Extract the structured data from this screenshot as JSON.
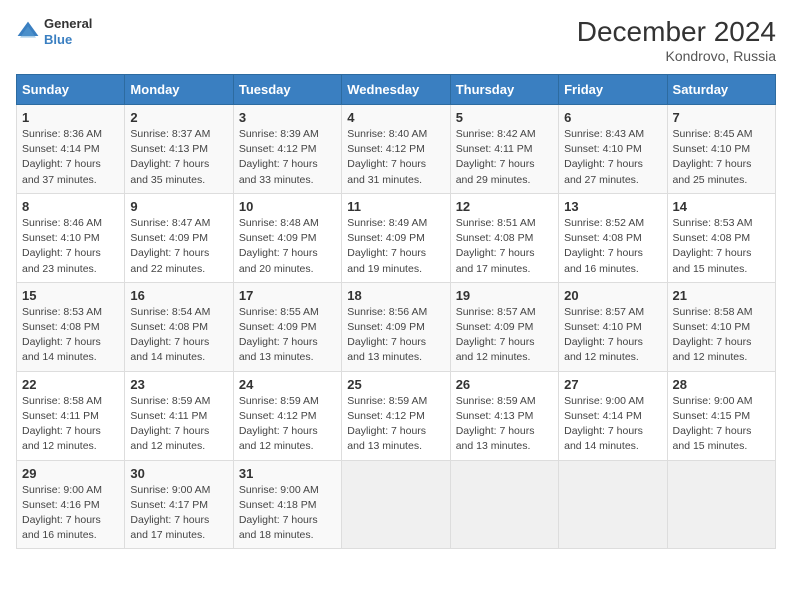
{
  "header": {
    "logo_line1": "General",
    "logo_line2": "Blue",
    "title": "December 2024",
    "subtitle": "Kondrovo, Russia"
  },
  "weekdays": [
    "Sunday",
    "Monday",
    "Tuesday",
    "Wednesday",
    "Thursday",
    "Friday",
    "Saturday"
  ],
  "weeks": [
    [
      {
        "day": 1,
        "info": "Sunrise: 8:36 AM\nSunset: 4:14 PM\nDaylight: 7 hours\nand 37 minutes."
      },
      {
        "day": 2,
        "info": "Sunrise: 8:37 AM\nSunset: 4:13 PM\nDaylight: 7 hours\nand 35 minutes."
      },
      {
        "day": 3,
        "info": "Sunrise: 8:39 AM\nSunset: 4:12 PM\nDaylight: 7 hours\nand 33 minutes."
      },
      {
        "day": 4,
        "info": "Sunrise: 8:40 AM\nSunset: 4:12 PM\nDaylight: 7 hours\nand 31 minutes."
      },
      {
        "day": 5,
        "info": "Sunrise: 8:42 AM\nSunset: 4:11 PM\nDaylight: 7 hours\nand 29 minutes."
      },
      {
        "day": 6,
        "info": "Sunrise: 8:43 AM\nSunset: 4:10 PM\nDaylight: 7 hours\nand 27 minutes."
      },
      {
        "day": 7,
        "info": "Sunrise: 8:45 AM\nSunset: 4:10 PM\nDaylight: 7 hours\nand 25 minutes."
      }
    ],
    [
      {
        "day": 8,
        "info": "Sunrise: 8:46 AM\nSunset: 4:10 PM\nDaylight: 7 hours\nand 23 minutes."
      },
      {
        "day": 9,
        "info": "Sunrise: 8:47 AM\nSunset: 4:09 PM\nDaylight: 7 hours\nand 22 minutes."
      },
      {
        "day": 10,
        "info": "Sunrise: 8:48 AM\nSunset: 4:09 PM\nDaylight: 7 hours\nand 20 minutes."
      },
      {
        "day": 11,
        "info": "Sunrise: 8:49 AM\nSunset: 4:09 PM\nDaylight: 7 hours\nand 19 minutes."
      },
      {
        "day": 12,
        "info": "Sunrise: 8:51 AM\nSunset: 4:08 PM\nDaylight: 7 hours\nand 17 minutes."
      },
      {
        "day": 13,
        "info": "Sunrise: 8:52 AM\nSunset: 4:08 PM\nDaylight: 7 hours\nand 16 minutes."
      },
      {
        "day": 14,
        "info": "Sunrise: 8:53 AM\nSunset: 4:08 PM\nDaylight: 7 hours\nand 15 minutes."
      }
    ],
    [
      {
        "day": 15,
        "info": "Sunrise: 8:53 AM\nSunset: 4:08 PM\nDaylight: 7 hours\nand 14 minutes."
      },
      {
        "day": 16,
        "info": "Sunrise: 8:54 AM\nSunset: 4:08 PM\nDaylight: 7 hours\nand 14 minutes."
      },
      {
        "day": 17,
        "info": "Sunrise: 8:55 AM\nSunset: 4:09 PM\nDaylight: 7 hours\nand 13 minutes."
      },
      {
        "day": 18,
        "info": "Sunrise: 8:56 AM\nSunset: 4:09 PM\nDaylight: 7 hours\nand 13 minutes."
      },
      {
        "day": 19,
        "info": "Sunrise: 8:57 AM\nSunset: 4:09 PM\nDaylight: 7 hours\nand 12 minutes."
      },
      {
        "day": 20,
        "info": "Sunrise: 8:57 AM\nSunset: 4:10 PM\nDaylight: 7 hours\nand 12 minutes."
      },
      {
        "day": 21,
        "info": "Sunrise: 8:58 AM\nSunset: 4:10 PM\nDaylight: 7 hours\nand 12 minutes."
      }
    ],
    [
      {
        "day": 22,
        "info": "Sunrise: 8:58 AM\nSunset: 4:11 PM\nDaylight: 7 hours\nand 12 minutes."
      },
      {
        "day": 23,
        "info": "Sunrise: 8:59 AM\nSunset: 4:11 PM\nDaylight: 7 hours\nand 12 minutes."
      },
      {
        "day": 24,
        "info": "Sunrise: 8:59 AM\nSunset: 4:12 PM\nDaylight: 7 hours\nand 12 minutes."
      },
      {
        "day": 25,
        "info": "Sunrise: 8:59 AM\nSunset: 4:12 PM\nDaylight: 7 hours\nand 13 minutes."
      },
      {
        "day": 26,
        "info": "Sunrise: 8:59 AM\nSunset: 4:13 PM\nDaylight: 7 hours\nand 13 minutes."
      },
      {
        "day": 27,
        "info": "Sunrise: 9:00 AM\nSunset: 4:14 PM\nDaylight: 7 hours\nand 14 minutes."
      },
      {
        "day": 28,
        "info": "Sunrise: 9:00 AM\nSunset: 4:15 PM\nDaylight: 7 hours\nand 15 minutes."
      }
    ],
    [
      {
        "day": 29,
        "info": "Sunrise: 9:00 AM\nSunset: 4:16 PM\nDaylight: 7 hours\nand 16 minutes."
      },
      {
        "day": 30,
        "info": "Sunrise: 9:00 AM\nSunset: 4:17 PM\nDaylight: 7 hours\nand 17 minutes."
      },
      {
        "day": 31,
        "info": "Sunrise: 9:00 AM\nSunset: 4:18 PM\nDaylight: 7 hours\nand 18 minutes."
      },
      null,
      null,
      null,
      null
    ]
  ]
}
